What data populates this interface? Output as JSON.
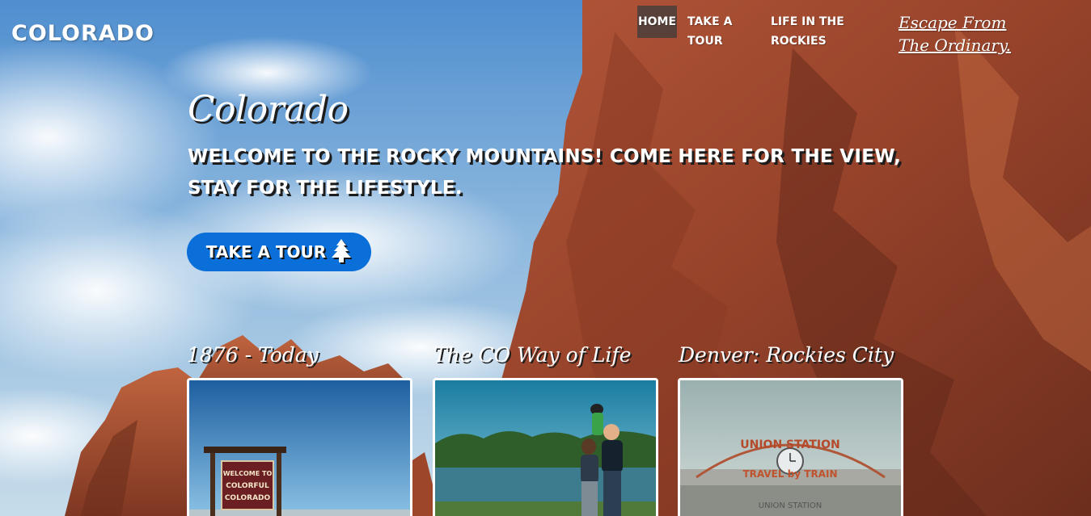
{
  "nav": {
    "brand": "COLORADO",
    "items": [
      {
        "label": "HOME"
      },
      {
        "label": "TAKE A TOUR"
      },
      {
        "label": "LIFE IN THE ROCKIES"
      }
    ],
    "escape_link": "Escape From The Ordinary."
  },
  "hero": {
    "title": "Colorado",
    "subtitle": "Welcome to the Rocky Mountains! Come here for the view, stay for the lifestyle.",
    "cta_label": "TAKE A TOUR",
    "cta_icon": "pine-tree-icon"
  },
  "cards": [
    {
      "title": "1876 - Today",
      "sign_lines": [
        "WELCOME TO",
        "COLORFUL",
        "COLORADO"
      ]
    },
    {
      "title": "The CO Way of Life"
    },
    {
      "title": "Denver: Rockies City",
      "sign_lines": [
        "UNION STATION",
        "TRAVEL by TRAIN",
        "UNION STATION"
      ]
    }
  ],
  "colors": {
    "accent": "#0a6fd9",
    "sky": "#6aa0cf",
    "rock": "#a2492b",
    "nav_active_bg": "#3c3c3c"
  }
}
